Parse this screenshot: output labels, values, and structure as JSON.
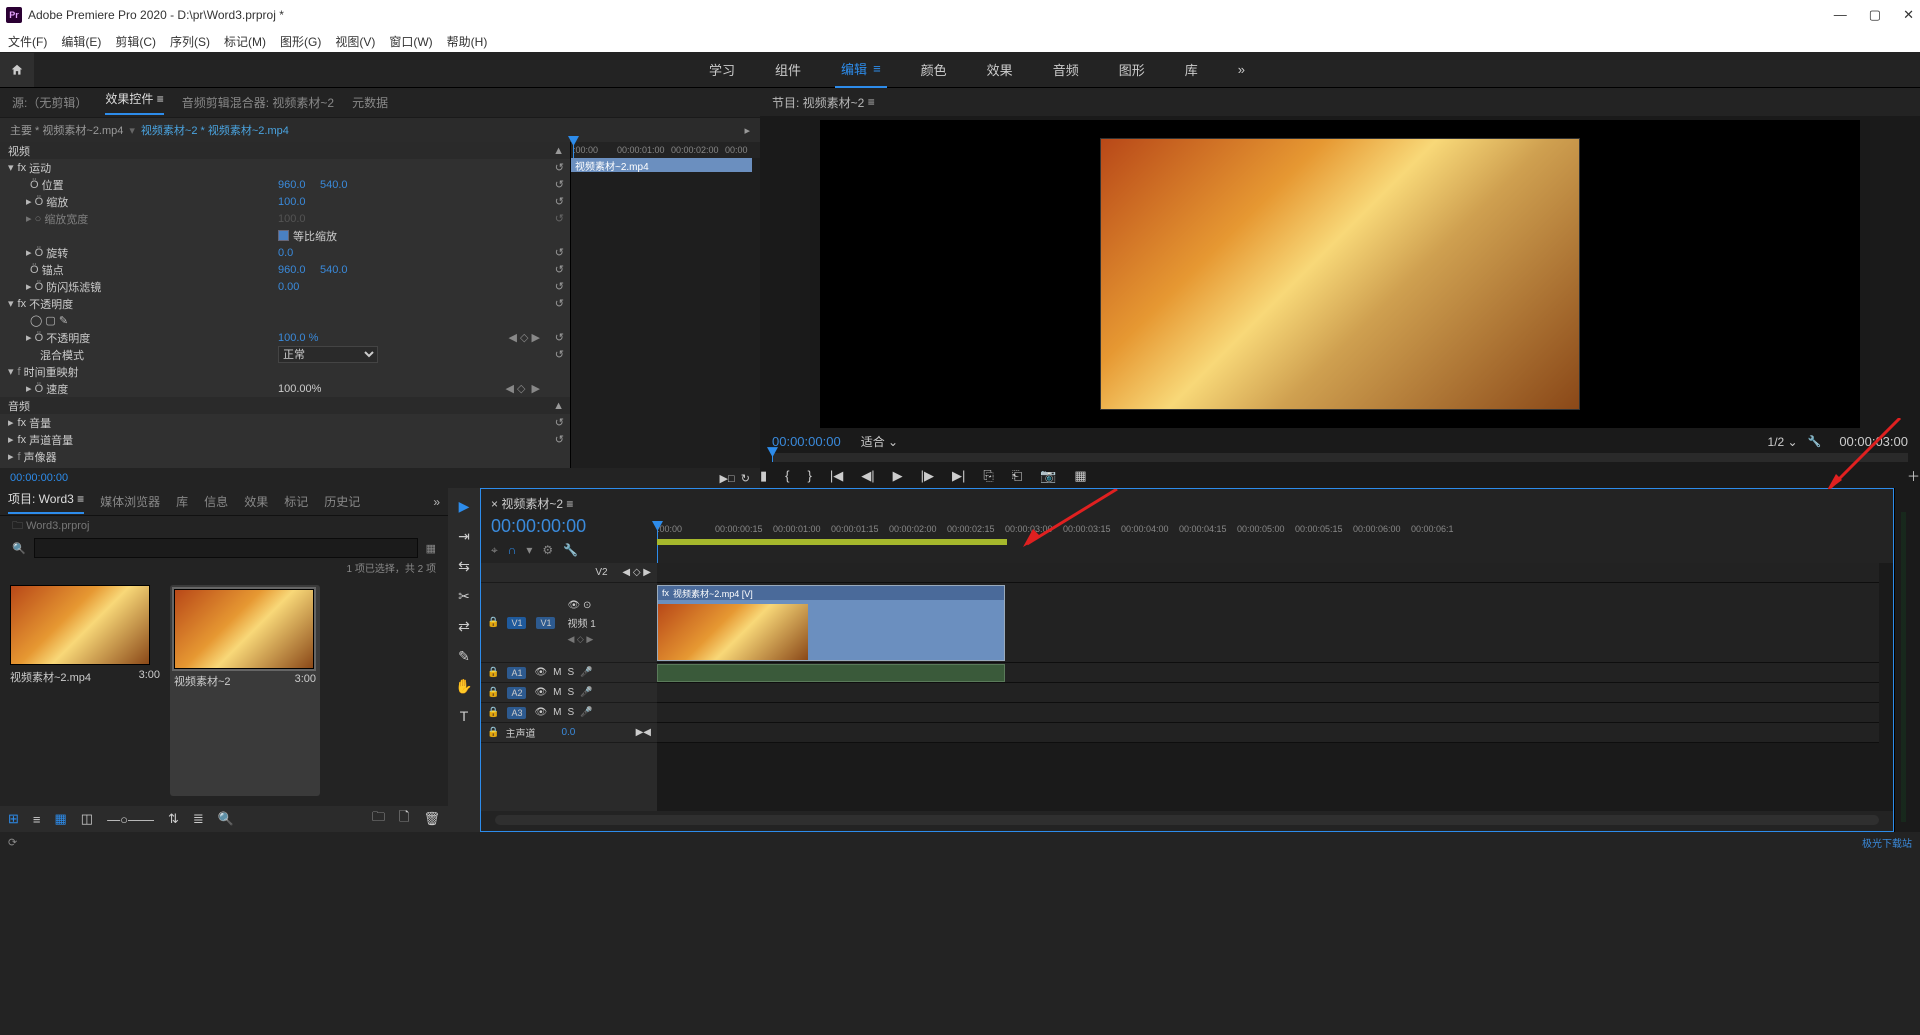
{
  "titlebar": {
    "app": "Pr",
    "title": "Adobe Premiere Pro 2020 - D:\\pr\\Word3.prproj *"
  },
  "menus": [
    "文件(F)",
    "编辑(E)",
    "剪辑(C)",
    "序列(S)",
    "标记(M)",
    "图形(G)",
    "视图(V)",
    "窗口(W)",
    "帮助(H)"
  ],
  "workspaces": [
    "学习",
    "组件",
    "编辑",
    "颜色",
    "效果",
    "音频",
    "图形",
    "库"
  ],
  "workspace_active": "编辑",
  "source_tabs": {
    "source": "源:（无剪辑）",
    "effects": "效果控件",
    "mixer": "音频剪辑混合器: 视频素材~2",
    "meta": "元数据"
  },
  "effect_crumb": {
    "master": "主要 * 视频素材~2.mp4",
    "seq": "视频素材~2 * 视频素材~2.mp4"
  },
  "mini_ruler": [
    ":00:00",
    "00:00:01:00",
    "00:00:02:00",
    "00:00"
  ],
  "mini_clip": "视频素材~2.mp4",
  "effects": {
    "video": "视频",
    "motion": "运动",
    "position": "位置",
    "position_x": "960.0",
    "position_y": "540.0",
    "scale": "缩放",
    "scale_v": "100.0",
    "scale_w": "缩放宽度",
    "scale_w_v": "100.0",
    "uniform": "等比缩放",
    "rotation": "旋转",
    "rotation_v": "0.0",
    "anchor": "锚点",
    "anchor_x": "960.0",
    "anchor_y": "540.0",
    "flicker": "防闪烁滤镜",
    "flicker_v": "0.00",
    "opacity": "不透明度",
    "opacity_prop": "不透明度",
    "opacity_v": "100.0 %",
    "blend": "混合模式",
    "blend_v": "正常",
    "timeremap": "时间重映射",
    "speed": "速度",
    "speed_v": "100.00%",
    "audio": "音频",
    "volume": "音量",
    "ch_volume": "声道音量",
    "panner": "声像器"
  },
  "effect_tc": "00:00:00:00",
  "program": {
    "tab": "节目: 视频素材~2",
    "tc": "00:00:00:00",
    "fit": "适合",
    "scale": "1/2",
    "dur": "00:00:03:00"
  },
  "project": {
    "tabs": {
      "project": "项目: Word3",
      "browser": "媒体浏览器",
      "lib": "库",
      "info": "信息",
      "fx": "效果",
      "mark": "标记",
      "hist": "历史记"
    },
    "path": "Word3.prproj",
    "search_ph": "",
    "count": "1 项已选择，共 2 项",
    "items": [
      {
        "name": "视频素材~2.mp4",
        "dur": "3:00"
      },
      {
        "name": "视频素材~2",
        "dur": "3:00"
      }
    ]
  },
  "timeline": {
    "seq": "视频素材~2",
    "tc": "00:00:00:00",
    "ruler": [
      ":00:00",
      "00:00:00:15",
      "00:00:01:00",
      "00:00:01:15",
      "00:00:02:00",
      "00:00:02:15",
      "00:00:03:00",
      "00:00:03:15",
      "00:00:04:00",
      "00:00:04:15",
      "00:00:05:00",
      "00:00:05:15",
      "00:00:06:00",
      "00:00:06:1"
    ],
    "v2": "V2",
    "v1": "V1",
    "v1_label": "视频 1",
    "a1": "A1",
    "a2": "A2",
    "a3": "A3",
    "master": "主声道",
    "master_v": "0.0",
    "clip_name": "视频素材~2.mp4 [V]",
    "ms": "M",
    "s": "S"
  },
  "watermark": "极光下载站"
}
